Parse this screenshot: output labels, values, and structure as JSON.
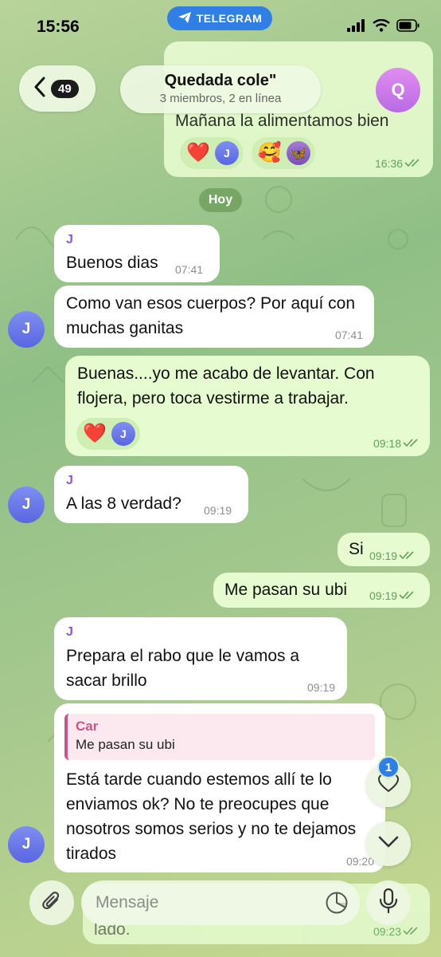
{
  "status_bar": {
    "time": "15:56",
    "app_pill": "TELEGRAM"
  },
  "header": {
    "back_count": "49",
    "title": "Quedada cole\"",
    "subtitle": "3 miembros, 2 en línea",
    "avatar_initial": "Q"
  },
  "top_message": {
    "text": "Mañana la alimentamos bien",
    "time": "16:36",
    "reactions": [
      {
        "emoji": "❤️",
        "avatar": "J"
      },
      {
        "emoji": "🥰",
        "avatar": "🦋"
      }
    ]
  },
  "date_divider": "Hoy",
  "messages": [
    {
      "sender": "J",
      "text": "Buenos dias",
      "time": "07:41"
    },
    {
      "text": "Como van esos cuerpos? Por aquí con muchas ganitas",
      "time": "07:41",
      "avatar": "J"
    },
    {
      "text": "Buenas....yo me acabo de levantar. Con flojera, pero toca vestirme a trabajar.",
      "time": "09:18",
      "reaction_emoji": "❤️",
      "reaction_avatar": "J"
    },
    {
      "sender": "J",
      "text": "A las 8 verdad?",
      "time": "09:19",
      "avatar": "J"
    },
    {
      "text": "Si",
      "time": "09:19"
    },
    {
      "text": "Me pasan su ubi",
      "time": "09:19"
    },
    {
      "sender": "J",
      "text": "Prepara el rabo que le vamos a sacar brillo",
      "time": "09:19"
    },
    {
      "reply_author": "Car",
      "reply_text": "Me pasan su ubi",
      "text": "Está tarde cuando estemos allí te lo enviamos ok? No te preocupes que nosotros somos serios y no te dejamos tirados",
      "time": "09:20",
      "avatar": "J"
    }
  ],
  "bottom_peek": {
    "text": "lado.",
    "time": "09:23"
  },
  "floating": {
    "badge_count": "1"
  },
  "input": {
    "placeholder": "Mensaje"
  },
  "colors": {
    "accent": "#2f7fe6",
    "outgoing_bubble": "#e6fbcf",
    "incoming_bubble": "#ffffff",
    "sender_name": "#8a5bc9",
    "reply_accent": "#c6558a"
  }
}
